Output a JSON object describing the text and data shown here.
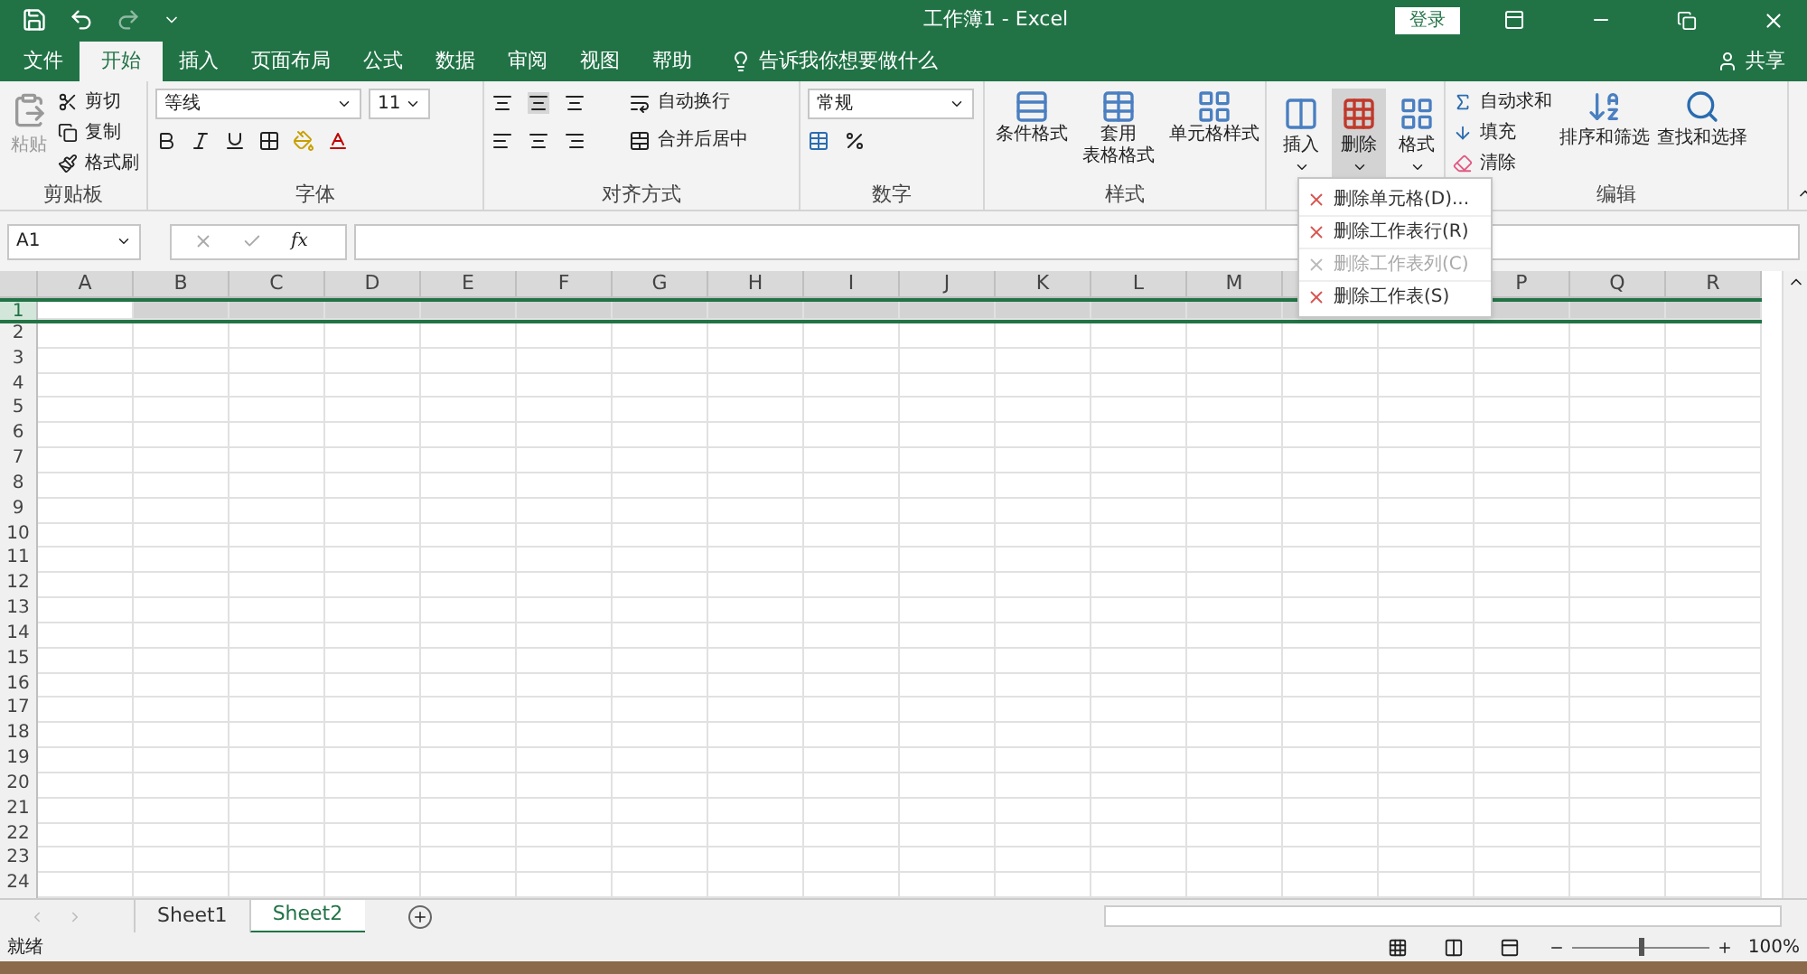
{
  "window": {
    "title": "工作簿1  -  Excel",
    "login": "登录",
    "share": "共享"
  },
  "tabs": [
    {
      "label": "文件",
      "selected": false
    },
    {
      "label": "开始",
      "selected": true
    },
    {
      "label": "插入",
      "selected": false
    },
    {
      "label": "页面布局",
      "selected": false
    },
    {
      "label": "公式",
      "selected": false
    },
    {
      "label": "数据",
      "selected": false
    },
    {
      "label": "审阅",
      "selected": false
    },
    {
      "label": "视图",
      "selected": false
    },
    {
      "label": "帮助",
      "selected": false
    }
  ],
  "tell_me": {
    "placeholder": "告诉我你想要做什么"
  },
  "ribbon": {
    "clipboard": {
      "label": "剪贴板",
      "paste": {
        "label": "粘贴",
        "disabled": true
      },
      "items": [
        "剪切",
        "复制",
        "格式刷"
      ]
    },
    "font": {
      "label": "字体",
      "name": "等线",
      "size": "11"
    },
    "alignment": {
      "label": "对齐方式",
      "wrap": "自动换行",
      "merge": "合并后居中"
    },
    "number": {
      "label": "数字",
      "format": "常规"
    },
    "styles": {
      "label": "样式",
      "items": [
        {
          "line1": "条件格式"
        },
        {
          "line1": "套用",
          "line2": "表格格式"
        },
        {
          "line1": "单元格样式"
        }
      ]
    },
    "cells": {
      "items": [
        {
          "label": "插入",
          "selected": false
        },
        {
          "label": "删除",
          "selected": true
        },
        {
          "label": "格式",
          "selected": false
        }
      ]
    },
    "editing": {
      "label": "编辑",
      "items": [
        "自动求和",
        "填充",
        "清除"
      ],
      "sort": "排序和筛选",
      "find": "查找和选择"
    }
  },
  "delete_menu": [
    {
      "label": "删除单元格(D)...",
      "disabled": false
    },
    {
      "label": "删除工作表行(R)",
      "disabled": false
    },
    {
      "label": "删除工作表列(C)",
      "disabled": true
    },
    {
      "label": "删除工作表(S)",
      "disabled": false
    }
  ],
  "formula_bar": {
    "name_box": "A1",
    "function_label": "fx"
  },
  "sheet": {
    "columns": [
      {
        "label": "A"
      },
      {
        "label": "B"
      },
      {
        "label": "C"
      },
      {
        "label": "D"
      },
      {
        "label": "E"
      },
      {
        "label": "F"
      },
      {
        "label": "G"
      },
      {
        "label": "H"
      },
      {
        "label": "I"
      },
      {
        "label": "J"
      },
      {
        "label": "K"
      },
      {
        "label": "L"
      },
      {
        "label": "M"
      },
      {},
      {},
      {
        "label": "P"
      },
      {
        "label": "Q"
      },
      {
        "label": "R"
      }
    ],
    "rows": [
      {
        "label": "1",
        "selected": true
      },
      {
        "label": "2",
        "selected": false
      },
      {
        "label": "3",
        "selected": false
      },
      {
        "label": "4",
        "selected": false
      },
      {
        "label": "5",
        "selected": false
      },
      {
        "label": "6",
        "selected": false
      },
      {
        "label": "7",
        "selected": false
      },
      {
        "label": "8",
        "selected": false
      },
      {
        "label": "9",
        "selected": false
      },
      {
        "label": "10",
        "selected": false
      },
      {
        "label": "11",
        "selected": false
      },
      {
        "label": "12",
        "selected": false
      },
      {
        "label": "13",
        "selected": false
      },
      {
        "label": "14",
        "selected": false
      },
      {
        "label": "15",
        "selected": false
      },
      {
        "label": "16",
        "selected": false
      },
      {
        "label": "17",
        "selected": false
      },
      {
        "label": "18",
        "selected": false
      },
      {
        "label": "19",
        "selected": false
      },
      {
        "label": "20",
        "selected": false
      },
      {
        "label": "21",
        "selected": false
      },
      {
        "label": "22",
        "selected": false
      },
      {
        "label": "23",
        "selected": false
      },
      {
        "label": "24",
        "selected": false
      }
    ]
  },
  "sheet_tabs": [
    {
      "label": "Sheet1",
      "selected": false
    },
    {
      "label": "Sheet2",
      "selected": true
    }
  ],
  "status_bar": {
    "status": "就绪",
    "zoom": "100%",
    "zoom_slider": {
      "level": 0.5
    }
  }
}
